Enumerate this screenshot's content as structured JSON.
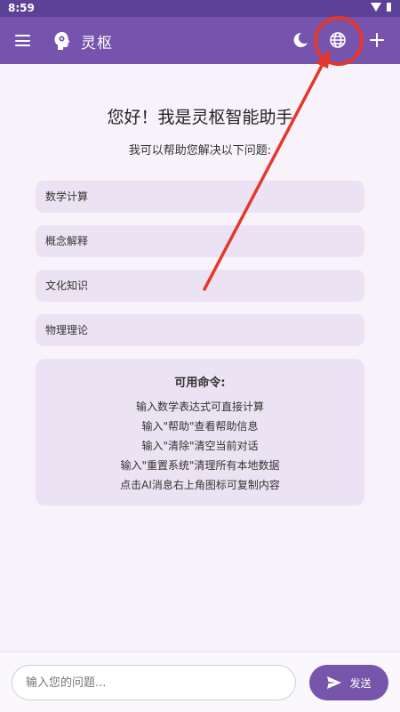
{
  "status_bar": {
    "time": "8:59",
    "icons": [
      "wifi-icon",
      "battery-icon"
    ]
  },
  "app_bar": {
    "title": "灵枢",
    "icons": [
      "menu-icon",
      "brain-icon",
      "moon-icon",
      "globe-icon",
      "plus-icon"
    ]
  },
  "welcome": {
    "title": "您好！我是灵枢智能助手",
    "subtitle": "我可以帮助您解决以下问题:"
  },
  "topics": [
    {
      "label": "数学计算"
    },
    {
      "label": "概念解释"
    },
    {
      "label": "文化知识"
    },
    {
      "label": "物理理论"
    }
  ],
  "commands": {
    "title": "可用命令:",
    "lines": [
      "输入数学表达式可直接计算",
      "输入\"帮助\"查看帮助信息",
      "输入\"清除\"清空当前对话",
      "输入\"重置系统\"清理所有本地数据",
      "点击AI消息右上角图标可复制内容"
    ]
  },
  "input": {
    "placeholder": "输入您的问题..."
  },
  "send": {
    "label": "发送"
  },
  "colors": {
    "app_bar": "#7654ad",
    "status_bar": "#5c4197",
    "card": "#ebe3f3",
    "background": "#f8f3fb",
    "send_button": "#7755ab",
    "annotation": "#e5372b"
  }
}
